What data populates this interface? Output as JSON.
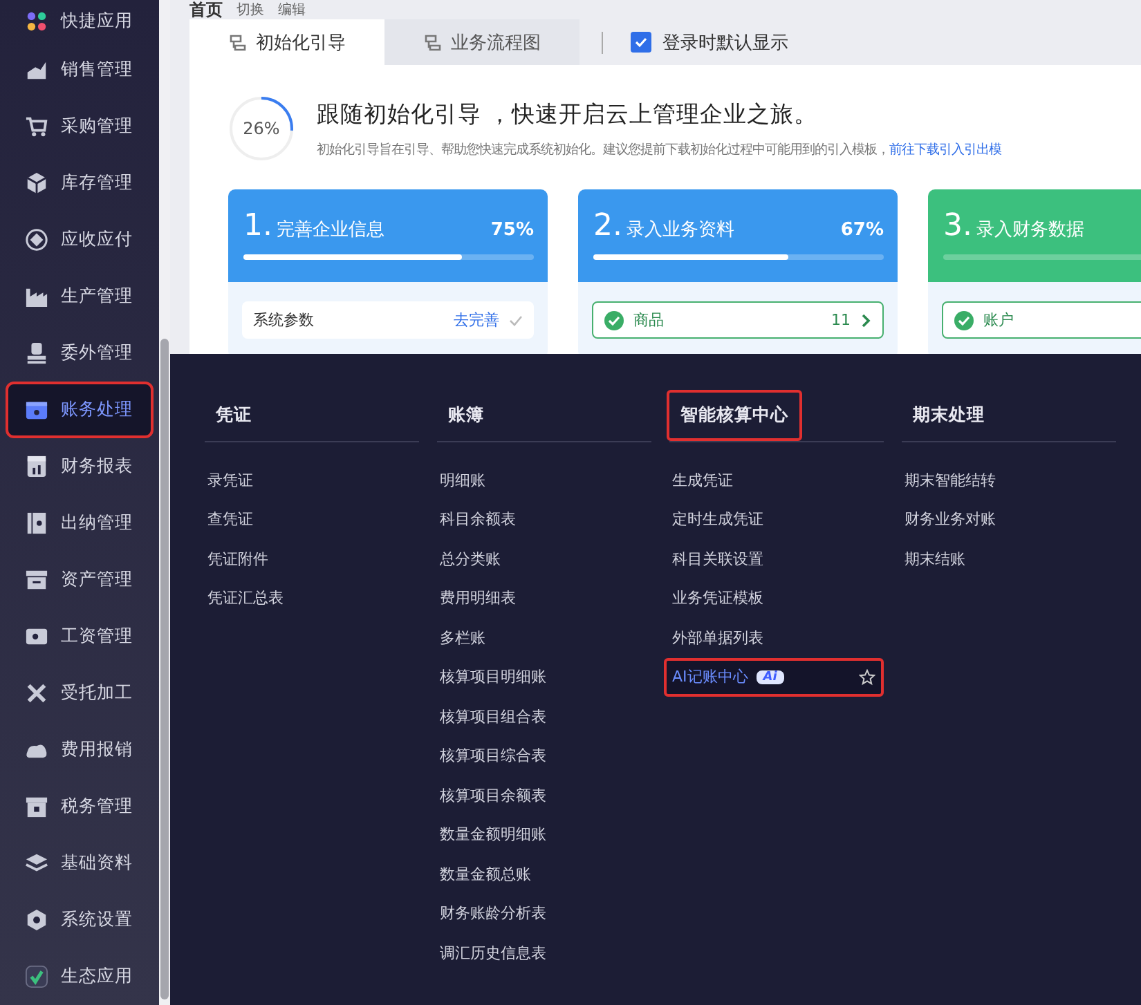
{
  "sidebar": {
    "items": [
      {
        "label": "快捷应用",
        "selected": false,
        "outlined": false
      },
      {
        "label": "销售管理",
        "selected": false,
        "outlined": false
      },
      {
        "label": "采购管理",
        "selected": false,
        "outlined": false
      },
      {
        "label": "库存管理",
        "selected": false,
        "outlined": false
      },
      {
        "label": "应收应付",
        "selected": false,
        "outlined": false
      },
      {
        "label": "生产管理",
        "selected": false,
        "outlined": false
      },
      {
        "label": "委外管理",
        "selected": false,
        "outlined": false
      },
      {
        "label": "账务处理",
        "selected": true,
        "outlined": true
      },
      {
        "label": "财务报表",
        "selected": false,
        "outlined": false
      },
      {
        "label": "出纳管理",
        "selected": false,
        "outlined": false
      },
      {
        "label": "资产管理",
        "selected": false,
        "outlined": false
      },
      {
        "label": "工资管理",
        "selected": false,
        "outlined": false
      },
      {
        "label": "受托加工",
        "selected": false,
        "outlined": false
      },
      {
        "label": "费用报销",
        "selected": false,
        "outlined": false
      },
      {
        "label": "税务管理",
        "selected": false,
        "outlined": false
      },
      {
        "label": "基础资料",
        "selected": false,
        "outlined": false
      },
      {
        "label": "系统设置",
        "selected": false,
        "outlined": false
      },
      {
        "label": "生态应用",
        "selected": false,
        "outlined": false
      }
    ]
  },
  "toolbar": {
    "title": "首页",
    "actions": [
      "切换",
      "编辑"
    ]
  },
  "tabs": [
    {
      "label": "初始化引导",
      "selected": true
    },
    {
      "label": "业务流程图",
      "selected": false
    }
  ],
  "default_display": {
    "label": "登录时默认显示",
    "checked": true
  },
  "guide": {
    "progress": {
      "text": "26%",
      "level": 0.26
    },
    "title": "跟随初始化引导 ，快速开启云上管理企业之旅。",
    "description": "初始化引导旨在引导、帮助您快速完成系统初始化。建议您提前下载初始化过程中可能用到的引入模板，",
    "link": "前往下载引入引出模"
  },
  "cards": [
    {
      "number": "1.",
      "title": "完善企业信息",
      "percent": "75%",
      "level": 0.75,
      "color": "#3a98ee",
      "task": {
        "kind": "todo",
        "label": "系统参数",
        "action": "去完善"
      }
    },
    {
      "number": "2.",
      "title": "录入业务资料",
      "percent": "67%",
      "level": 0.67,
      "color": "#3a98ee",
      "task": {
        "kind": "done",
        "label": "商品",
        "count": "11"
      }
    },
    {
      "number": "3.",
      "title": "录入财务数据",
      "color": "#3cc07e",
      "task": {
        "kind": "done",
        "label": "账户"
      }
    }
  ],
  "menu": {
    "columns": [
      {
        "title": "凭证",
        "outlined": false,
        "items": [
          {
            "label": "录凭证",
            "selected": false
          },
          {
            "label": "查凭证",
            "selected": false
          },
          {
            "label": "凭证附件",
            "selected": false
          },
          {
            "label": "凭证汇总表",
            "selected": false
          }
        ]
      },
      {
        "title": "账簿",
        "outlined": false,
        "items": [
          {
            "label": "明细账",
            "selected": false
          },
          {
            "label": "科目余额表",
            "selected": false
          },
          {
            "label": "总分类账",
            "selected": false
          },
          {
            "label": "费用明细表",
            "selected": false
          },
          {
            "label": "多栏账",
            "selected": false
          },
          {
            "label": "核算项目明细账",
            "selected": false
          },
          {
            "label": "核算项目组合表",
            "selected": false
          },
          {
            "label": "核算项目综合表",
            "selected": false
          },
          {
            "label": "核算项目余额表",
            "selected": false
          },
          {
            "label": "数量金额明细账",
            "selected": false
          },
          {
            "label": "数量金额总账",
            "selected": false
          },
          {
            "label": "财务账龄分析表",
            "selected": false
          },
          {
            "label": "调汇历史信息表",
            "selected": false
          }
        ]
      },
      {
        "title": "智能核算中心",
        "outlined": true,
        "items": [
          {
            "label": "生成凭证",
            "selected": false
          },
          {
            "label": "定时生成凭证",
            "selected": false
          },
          {
            "label": "科目关联设置",
            "selected": false
          },
          {
            "label": "业务凭证模板",
            "selected": false
          },
          {
            "label": "外部单据列表",
            "selected": false
          },
          {
            "label": "AI记账中心",
            "selected": true,
            "outlined": true,
            "badge": "Ai"
          }
        ]
      },
      {
        "title": "期末处理",
        "outlined": false,
        "items": [
          {
            "label": "期末智能结转",
            "selected": false
          },
          {
            "label": "财务业务对账",
            "selected": false
          },
          {
            "label": "期末结账",
            "selected": false
          }
        ]
      }
    ]
  }
}
